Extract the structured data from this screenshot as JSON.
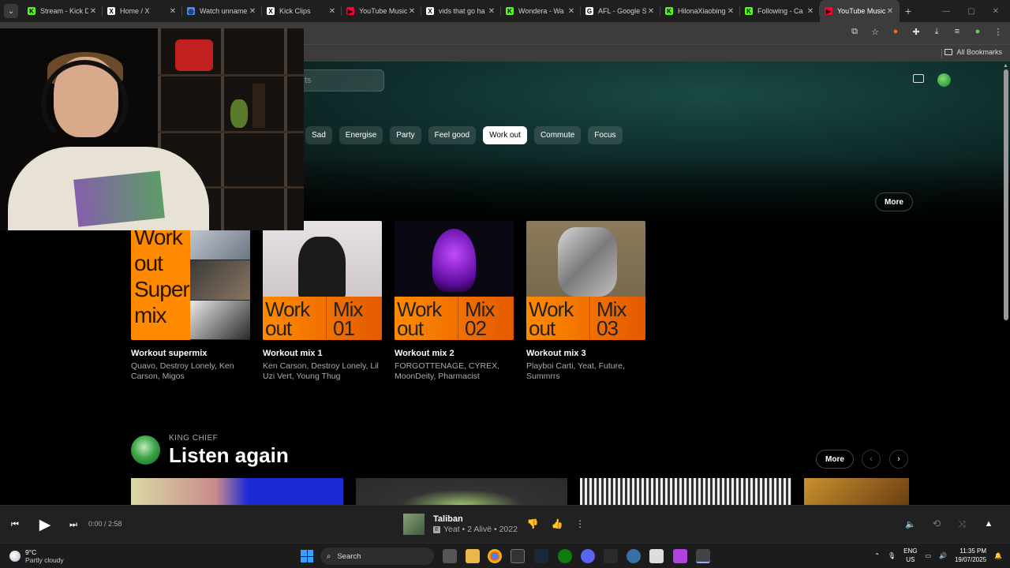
{
  "browser": {
    "tabs": [
      {
        "title": "Stream - Kick D",
        "fav_color": "#53fc18",
        "fav_glyph": "K",
        "active": false
      },
      {
        "title": "Home / X",
        "fav_color": "#ffffff",
        "fav_glyph": "X",
        "active": false
      },
      {
        "title": "Watch unname",
        "fav_color": "#4c8bf5",
        "fav_glyph": "◎",
        "active": false
      },
      {
        "title": "Kick Clips",
        "fav_color": "#ffffff",
        "fav_glyph": "X",
        "active": false
      },
      {
        "title": "YouTube Music",
        "fav_color": "#ff0033",
        "fav_glyph": "▶",
        "active": false
      },
      {
        "title": "vids that go ha",
        "fav_color": "#ffffff",
        "fav_glyph": "X",
        "active": false
      },
      {
        "title": "Wondera - Wa",
        "fav_color": "#53fc18",
        "fav_glyph": "K",
        "active": false
      },
      {
        "title": "AFL - Google S",
        "fav_color": "#ffffff",
        "fav_glyph": "G",
        "active": false
      },
      {
        "title": "HilonaXiaobing",
        "fav_color": "#53fc18",
        "fav_glyph": "K",
        "active": false
      },
      {
        "title": "Following - Ca",
        "fav_color": "#53fc18",
        "fav_glyph": "K",
        "active": false
      },
      {
        "title": "YouTube Music",
        "fav_color": "#ff0033",
        "fav_glyph": "▶",
        "active": true
      }
    ],
    "close_glyph": "✕",
    "newtab_glyph": "+",
    "bookmarks_label": "All Bookmarks"
  },
  "search": {
    "placeholder": "ts"
  },
  "chips": [
    {
      "label": "Sad",
      "active": false
    },
    {
      "label": "Energise",
      "active": false
    },
    {
      "label": "Party",
      "active": false
    },
    {
      "label": "Feel good",
      "active": false
    },
    {
      "label": "Work out",
      "active": true
    },
    {
      "label": "Commute",
      "active": false
    },
    {
      "label": "Focus",
      "active": false
    }
  ],
  "mixes_section": {
    "more_label": "More"
  },
  "cards": [
    {
      "title": "Workout supermix",
      "subtitle": "Quavo, Destroy Lonely, Ken Carson, Migos",
      "art_text": [
        "Work",
        "out",
        "Super",
        "mix"
      ]
    },
    {
      "title": "Workout mix 1",
      "subtitle": "Ken Carson, Destroy Lonely, Lil Uzi Vert, Young Thug",
      "art_text": [
        "Work",
        "out",
        "Mix",
        "01"
      ]
    },
    {
      "title": "Workout mix 2",
      "subtitle": "FORGOTTENAGE, CYREX, MoonDeity, Pharmacist",
      "art_text": [
        "Work",
        "out",
        "Mix",
        "02"
      ]
    },
    {
      "title": "Workout mix 3",
      "subtitle": "Playboi Carti, Yeat, Future, Summrrs",
      "art_text": [
        "Work",
        "out",
        "Mix",
        "03"
      ]
    }
  ],
  "listen_again": {
    "user": "KING CHIEF",
    "title": "Listen again",
    "more_label": "More",
    "prev_glyph": "‹",
    "next_glyph": "›"
  },
  "player": {
    "time": "0:00 / 2:58",
    "track_title": "Taliban",
    "track_meta": "Yeat • 2 Alivë • 2022",
    "explicit_mark": "E"
  },
  "taskbar": {
    "temperature": "9°C",
    "weather": "Partly cloudy",
    "search_label": "Search",
    "lang_top": "ENG",
    "lang_bottom": "US",
    "time": "11:35 PM",
    "date": "19/07/2025"
  }
}
